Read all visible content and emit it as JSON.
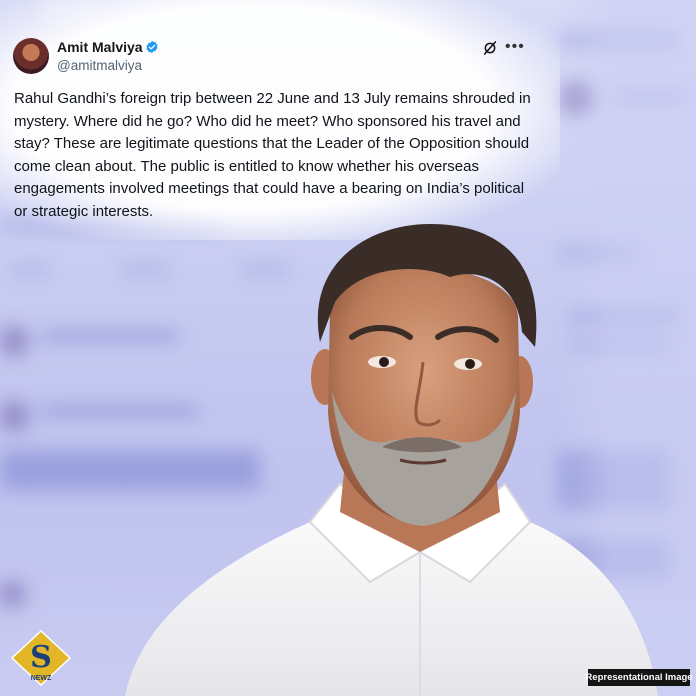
{
  "post": {
    "author_name": "Amit Malviya",
    "handle": "@amitmalviya",
    "text": "Rahul Gandhi’s foreign trip between 22 June and 13 July remains shrouded in mystery. Where did he go? Who did he meet? Who sponsored his travel and stay? These are legitimate questions that the Leader of the Opposition should come clean about. The public is entitled to know whether his overseas engagements involved meetings that could have a bearing on India’s political or strategic interests."
  },
  "icons": {
    "verified": "verified-badge-icon",
    "grok": "grok-icon",
    "more": "more-options-icon"
  },
  "caption": "Representational Image",
  "logo": {
    "letter": "S",
    "subtext": "NEWZ"
  },
  "colors": {
    "verified": "#1d9bf0",
    "logo_gold": "#e3b628",
    "background": "#c9cdf0"
  }
}
